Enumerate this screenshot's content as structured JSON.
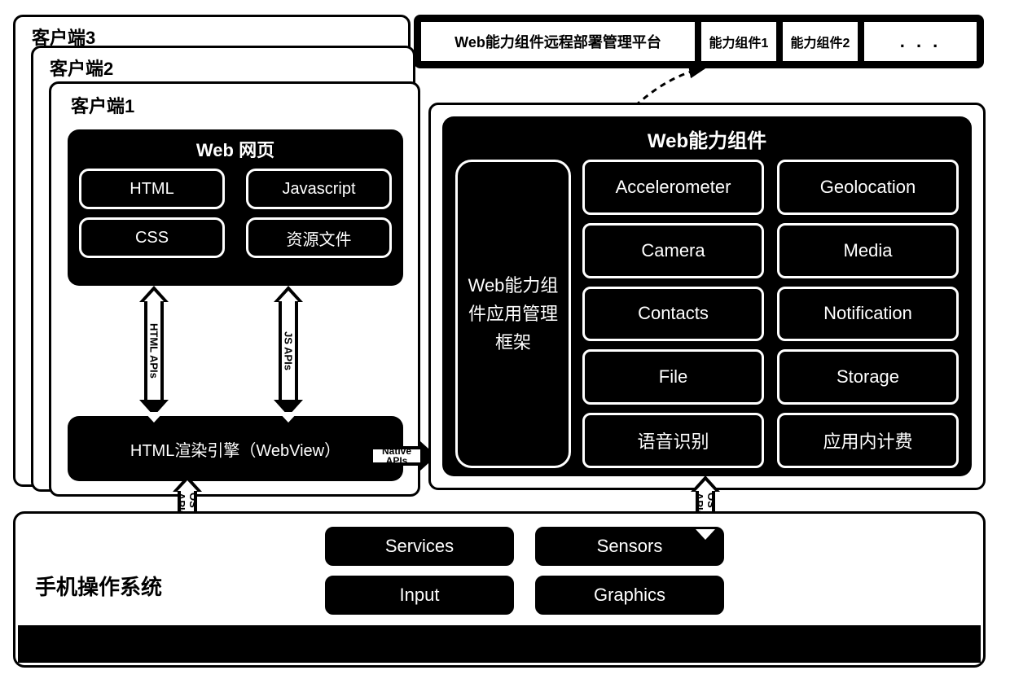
{
  "remote": {
    "title": "Web能力组件远程部署管理平台",
    "items": [
      "能力组件1",
      "能力组件2",
      ". . ."
    ]
  },
  "clients": {
    "client3": "客户端3",
    "client2": "客户端2",
    "client1": "客户端1"
  },
  "web": {
    "title": "Web 网页",
    "items": [
      "HTML",
      "Javascript",
      "CSS",
      "资源文件"
    ]
  },
  "webview": "HTML渲染引擎（WebView）",
  "arrows": {
    "html_apis": "HTML APIs",
    "js_apis": "JS APIs",
    "native_apis": "Native APIs",
    "os_apis_left": "OS APIs",
    "os_apis_right": "OS APIs"
  },
  "capability": {
    "title": "Web能力组件",
    "manager": "Web能力组件应用管理框架",
    "items": [
      "Accelerometer",
      "Geolocation",
      "Camera",
      "Media",
      "Contacts",
      "Notification",
      "File",
      "Storage",
      "语音识别",
      "应用内计费"
    ]
  },
  "os": {
    "title": "手机操作系统",
    "items": [
      "Services",
      "Sensors",
      "Input",
      "Graphics"
    ]
  }
}
